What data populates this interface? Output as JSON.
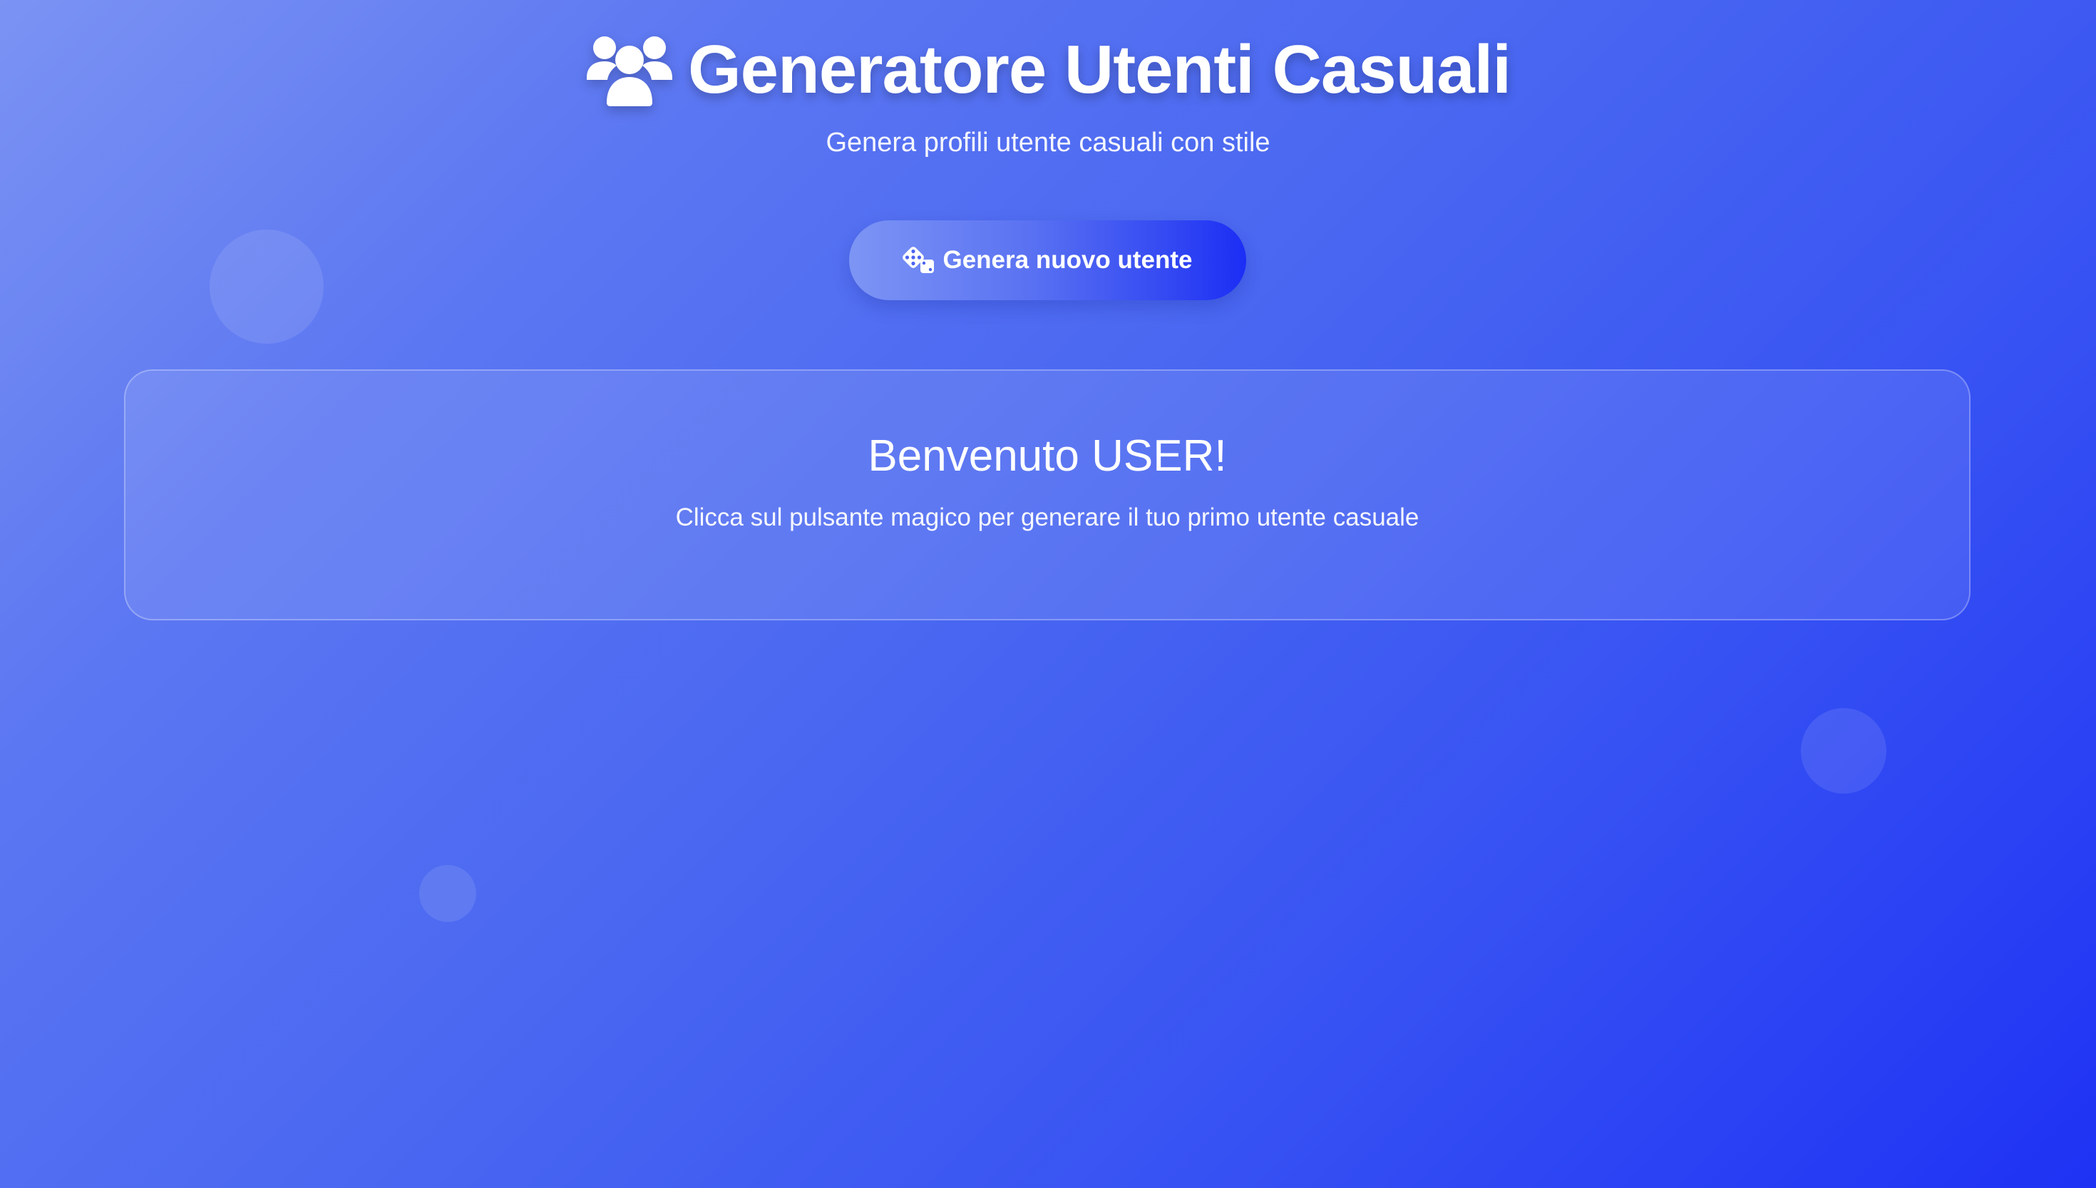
{
  "header": {
    "icon": "users-icon",
    "title": "Generatore Utenti Casuali",
    "subtitle": "Genera profili utente casuali con stile"
  },
  "generate_button": {
    "icon": "dice-icon",
    "label": "Genera nuovo utente"
  },
  "welcome_card": {
    "title": "Benvenuto USER!",
    "text": "Clicca sul pulsante magico per generare il tuo primo utente casuale"
  },
  "colors": {
    "background_start": "#7b93f3",
    "background_end": "#1e32f4",
    "button_start": "#7d95f4",
    "button_end": "#1b2ef5",
    "text": "#ffffff"
  }
}
